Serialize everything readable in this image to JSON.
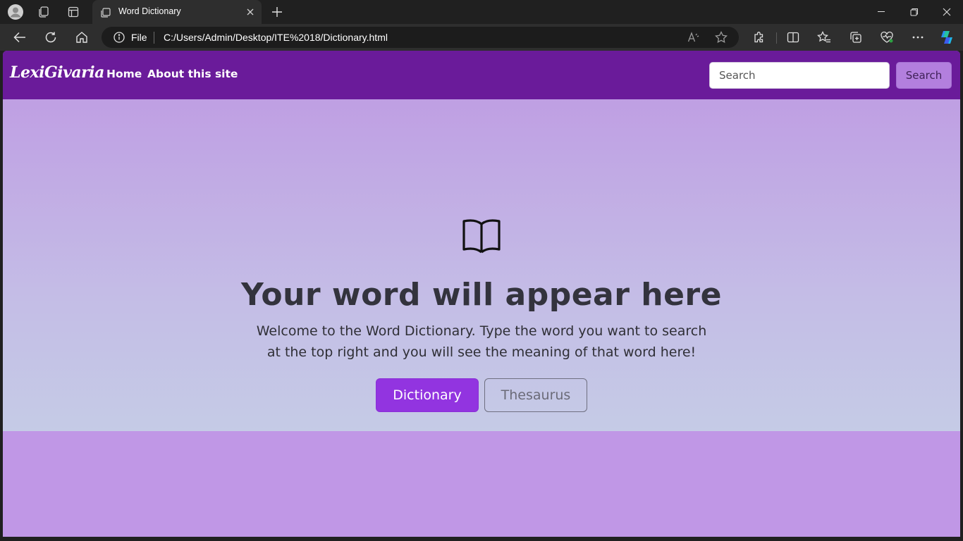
{
  "browser": {
    "tab_title": "Word Dictionary",
    "address_prefix": "File",
    "url": "C:/Users/Admin/Desktop/ITE%2018/Dictionary.html",
    "icons": [
      "profile-icon",
      "workspaces-icon",
      "tab-actions-icon",
      "tab-favicon",
      "close-tab-icon",
      "new-tab-icon",
      "minimize-icon",
      "restore-icon",
      "close-window-icon",
      "back-icon",
      "refresh-icon",
      "home-icon",
      "info-icon",
      "read-aloud-icon",
      "favorite-star-icon",
      "extensions-icon",
      "split-screen-icon",
      "favorites-icon",
      "collections-icon",
      "browser-essentials-icon",
      "more-icon",
      "copilot-icon"
    ]
  },
  "navbar": {
    "brand": "LexiGivaria",
    "links": [
      "Home",
      "About this site"
    ],
    "search_placeholder": "Search",
    "search_button": "Search",
    "color": "#6a1b9a"
  },
  "hero": {
    "icon": "book-icon",
    "title": "Your word will appear here",
    "description": "Welcome to the Word Dictionary. Type the word you want to search at the top right and you will see the meaning of that word here!",
    "buttons": {
      "dictionary": "Dictionary",
      "thesaurus": "Thesaurus"
    },
    "accent": "#9234e0"
  }
}
